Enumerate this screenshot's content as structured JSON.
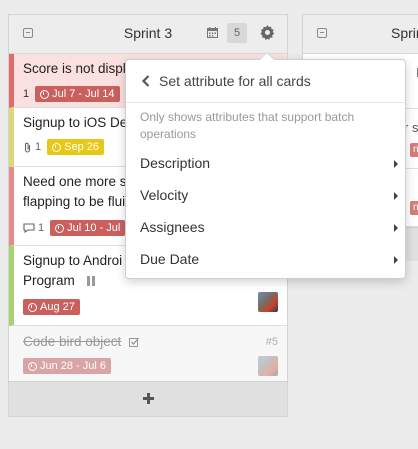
{
  "list1": {
    "title": "Sprint 3",
    "count": "5",
    "cards": [
      {
        "title": "Score is not displ",
        "meta_prefix": "1",
        "date": "Jul 7 - Jul 14"
      },
      {
        "title": "Signup to iOS Dev",
        "attachments": "1",
        "date": "Sep 26"
      },
      {
        "title": "Need one more s",
        "title_line2": "flapping to be flui",
        "comments": "1",
        "date": "Jul 10 - Jul"
      },
      {
        "title": "Signup to Androi",
        "title_line2": "Program",
        "date": "Aug 27"
      },
      {
        "title": "Code bird object",
        "number": "#5",
        "date": "Jun 28 - Jul 6"
      }
    ]
  },
  "list2": {
    "title": "Sprin",
    "fragments": {
      "top": "I",
      "mid": "r s",
      "label1": "n -",
      "label2": "n"
    }
  },
  "popover": {
    "title": "Set attribute for all cards",
    "hint": "Only shows attributes that support batch operations",
    "items": [
      {
        "label": "Description"
      },
      {
        "label": "Velocity"
      },
      {
        "label": "Assignees"
      },
      {
        "label": "Due Date"
      }
    ]
  },
  "colors": {
    "accent_red": "#e26a6a",
    "label_yellow": "#e8c817",
    "label_red": "#c9605e"
  }
}
